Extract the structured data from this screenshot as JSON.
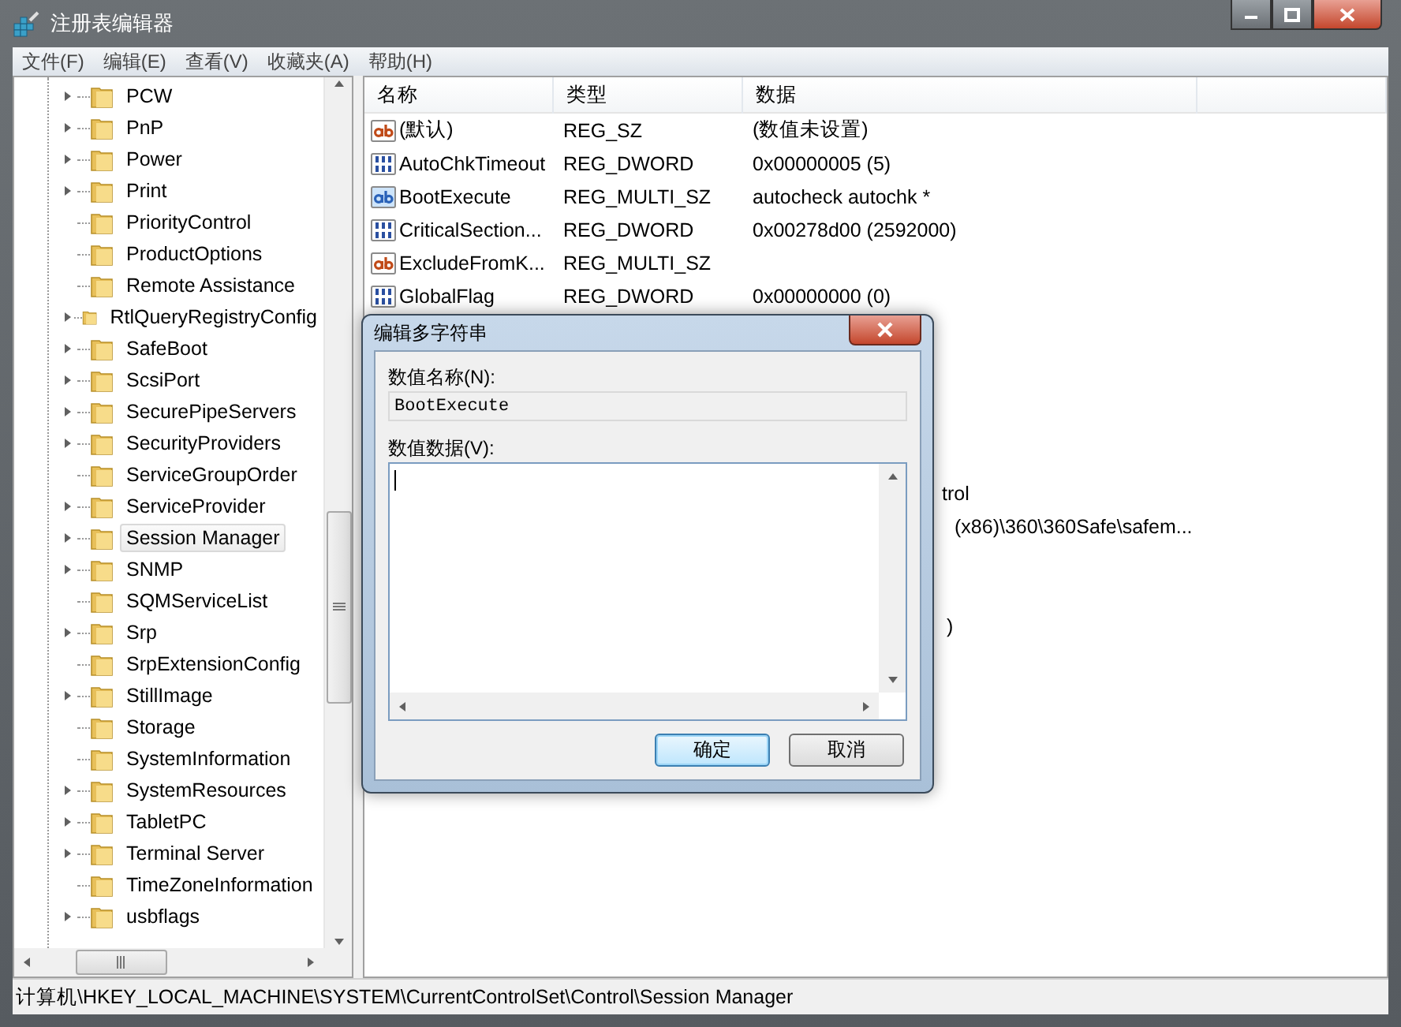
{
  "window": {
    "title": "注册表编辑器"
  },
  "menu": [
    "文件(F)",
    "编辑(E)",
    "查看(V)",
    "收藏夹(A)",
    "帮助(H)"
  ],
  "tree": [
    {
      "label": "PCW",
      "expandable": true,
      "selected": false
    },
    {
      "label": "PnP",
      "expandable": true,
      "selected": false
    },
    {
      "label": "Power",
      "expandable": true,
      "selected": false
    },
    {
      "label": "Print",
      "expandable": true,
      "selected": false
    },
    {
      "label": "PriorityControl",
      "expandable": false,
      "selected": false
    },
    {
      "label": "ProductOptions",
      "expandable": false,
      "selected": false
    },
    {
      "label": "Remote Assistance",
      "expandable": false,
      "selected": false
    },
    {
      "label": "RtlQueryRegistryConfig",
      "expandable": true,
      "selected": false
    },
    {
      "label": "SafeBoot",
      "expandable": true,
      "selected": false
    },
    {
      "label": "ScsiPort",
      "expandable": true,
      "selected": false
    },
    {
      "label": "SecurePipeServers",
      "expandable": true,
      "selected": false
    },
    {
      "label": "SecurityProviders",
      "expandable": true,
      "selected": false
    },
    {
      "label": "ServiceGroupOrder",
      "expandable": false,
      "selected": false
    },
    {
      "label": "ServiceProvider",
      "expandable": true,
      "selected": false
    },
    {
      "label": "Session Manager",
      "expandable": true,
      "selected": true
    },
    {
      "label": "SNMP",
      "expandable": true,
      "selected": false
    },
    {
      "label": "SQMServiceList",
      "expandable": false,
      "selected": false
    },
    {
      "label": "Srp",
      "expandable": true,
      "selected": false
    },
    {
      "label": "SrpExtensionConfig",
      "expandable": false,
      "selected": false
    },
    {
      "label": "StillImage",
      "expandable": true,
      "selected": false
    },
    {
      "label": "Storage",
      "expandable": false,
      "selected": false
    },
    {
      "label": "SystemInformation",
      "expandable": false,
      "selected": false
    },
    {
      "label": "SystemResources",
      "expandable": true,
      "selected": false
    },
    {
      "label": "TabletPC",
      "expandable": true,
      "selected": false
    },
    {
      "label": "Terminal Server",
      "expandable": true,
      "selected": false
    },
    {
      "label": "TimeZoneInformation",
      "expandable": false,
      "selected": false
    },
    {
      "label": "usbflags",
      "expandable": true,
      "selected": false
    }
  ],
  "table": {
    "columns": [
      "名称",
      "类型",
      "数据"
    ],
    "rows": [
      {
        "kind": "string",
        "name": "(默认)",
        "type": "REG_SZ",
        "data": "(数值未设置)",
        "selected": false
      },
      {
        "kind": "binary",
        "name": "AutoChkTimeout",
        "type": "REG_DWORD",
        "data": "0x00000005 (5)",
        "selected": false
      },
      {
        "kind": "string",
        "name": "BootExecute",
        "type": "REG_MULTI_SZ",
        "data": "autocheck autochk *",
        "selected": true
      },
      {
        "kind": "binary",
        "name": "CriticalSection...",
        "type": "REG_DWORD",
        "data": "0x00278d00 (2592000)",
        "selected": false
      },
      {
        "kind": "string",
        "name": "ExcludeFromK...",
        "type": "REG_MULTI_SZ",
        "selected": false
      },
      {
        "kind": "binary",
        "name": "GlobalFlag",
        "type": "REG_DWORD",
        "data": "0x00000000 (0)",
        "selected": false
      }
    ],
    "covered_fragments": [
      "trol",
      "(x86)\\360\\360Safe\\safem...",
      ")"
    ]
  },
  "dialog": {
    "title": "编辑多字符串",
    "name_label": "数值名称(N):",
    "name_value": "BootExecute",
    "data_label": "数值数据(V):",
    "buttons": [
      {
        "label": "确定",
        "default": true
      },
      {
        "label": "取消",
        "default": false
      }
    ]
  },
  "status_bar": "计算机\\HKEY_LOCAL_MACHINE\\SYSTEM\\CurrentControlSet\\Control\\Session Manager"
}
